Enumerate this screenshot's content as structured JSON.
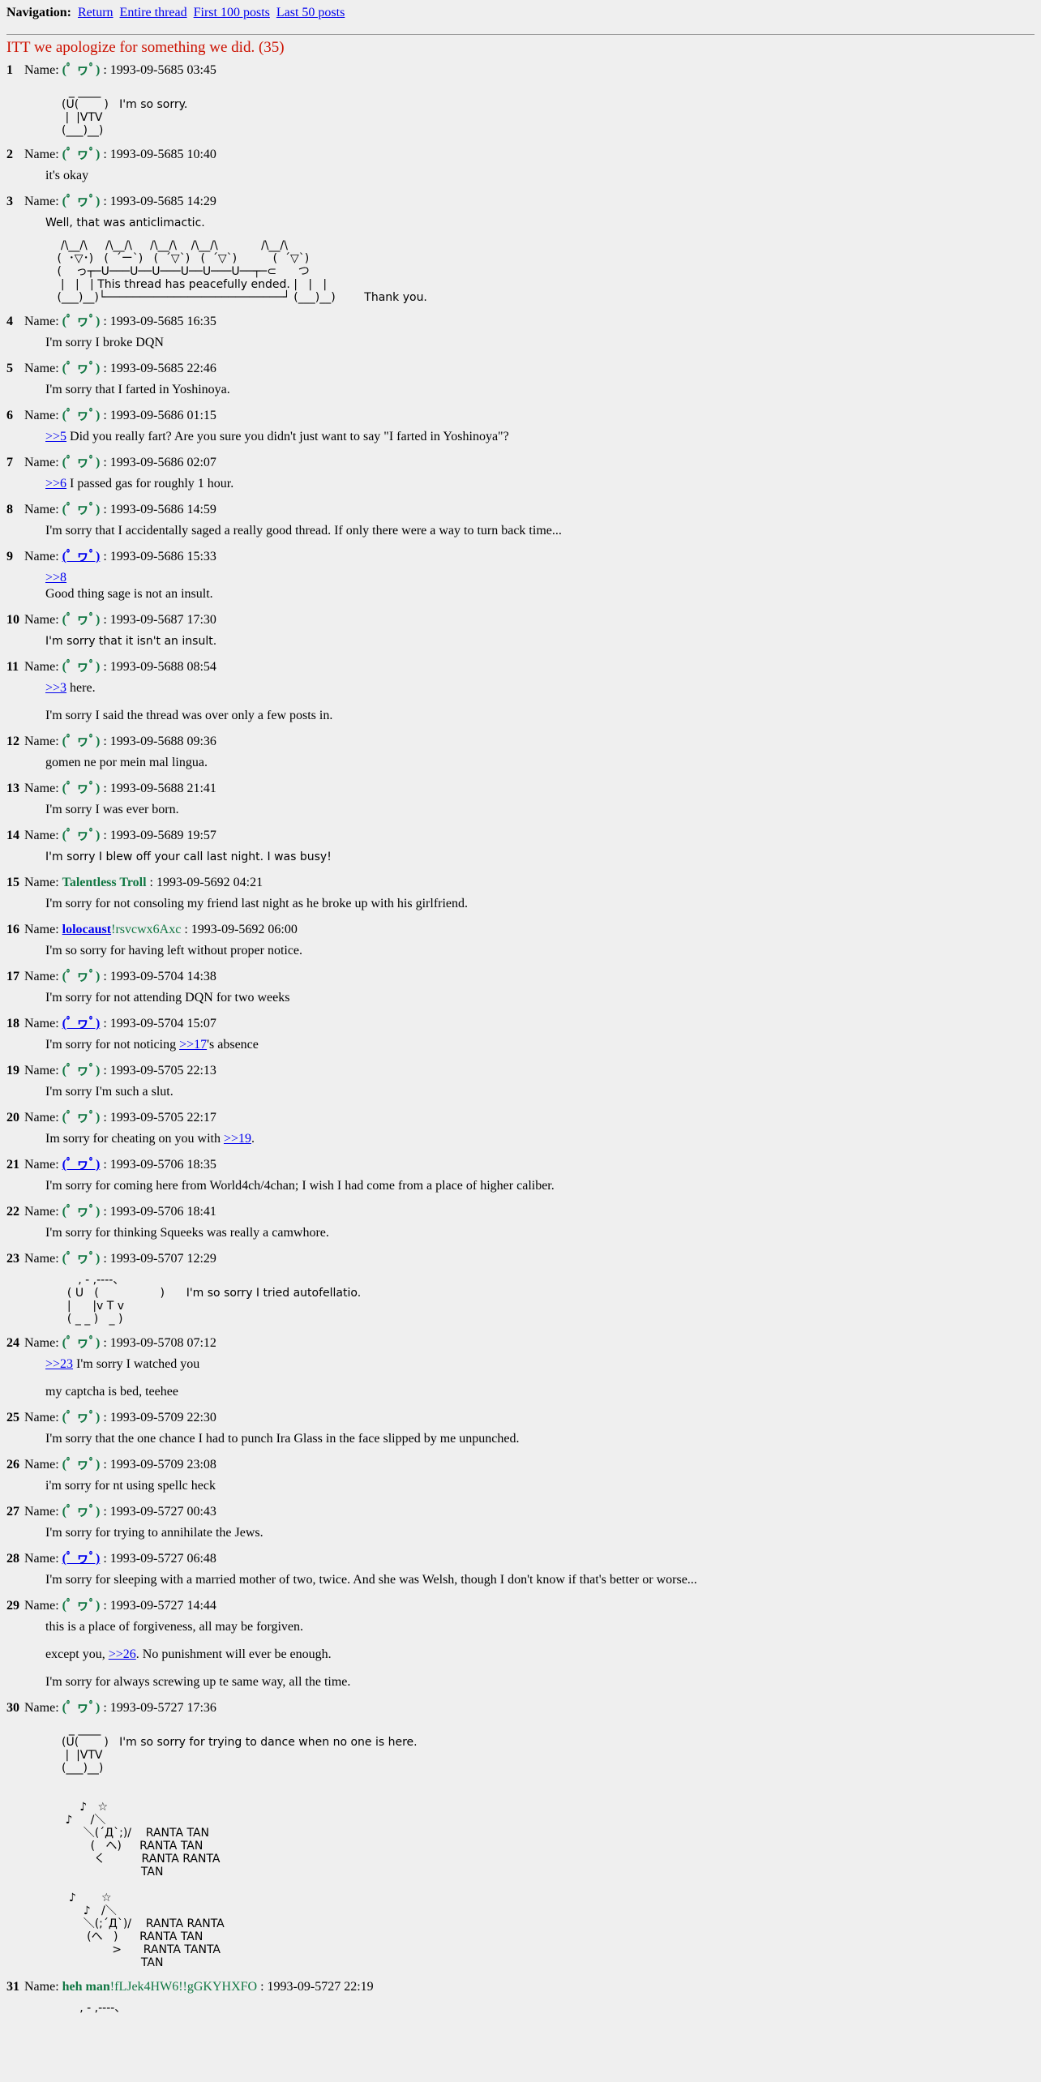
{
  "nav": {
    "label": "Navigation:",
    "links": [
      "Return",
      "Entire thread",
      "First 100 posts",
      "Last 50 posts"
    ]
  },
  "thread": {
    "title": "ITT we apologize for something we did. (35)"
  },
  "default_name": "(ﾟ ヮﾟ)",
  "posts": [
    {
      "num": "1",
      "name": "(ﾟ ヮﾟ)",
      "date": "1993-09-5685 03:45",
      "aa": "  _ ____\n(U(       )   I'm so sorry.\n |  |VTV\n(___)__)"
    },
    {
      "num": "2",
      "name": "(ﾟ ヮﾟ)",
      "date": "1993-09-5685 10:40",
      "lines": [
        "it's okay"
      ]
    },
    {
      "num": "3",
      "name": "(ﾟ ヮﾟ)",
      "date": "1993-09-5685 14:29",
      "lines": [
        "Well, that was anticlimactic."
      ],
      "aa": "  /\\__/\\     /\\__/\\     /\\__/\\    /\\__/\\            /\\__/\\\n (  ･▽･)   (  ´ー`)   (  ´▽`)   (  ´▽`)          (  ´▽`)\n (    っ┬─U───U──U───U──U───U──┬─⊂      つ\n  |   |   | This thread has peacefully ended. |   |   |\n (___)__)└──────────────────────────┘ (___)__)        Thank you."
    },
    {
      "num": "4",
      "name": "(ﾟ ヮﾟ)",
      "date": "1993-09-5685 16:35",
      "lines": [
        "I'm sorry I broke DQN"
      ]
    },
    {
      "num": "5",
      "name": "(ﾟ ヮﾟ)",
      "date": "1993-09-5685 22:46",
      "lines": [
        "I'm sorry that I farted in Yoshinoya."
      ]
    },
    {
      "num": "6",
      "name": "(ﾟ ヮﾟ)",
      "date": "1993-09-5686 01:15",
      "ref": ">>5",
      "lines": [
        " Did you really fart? Are you sure you didn't just want to say \"I farted in Yoshinoya\"?"
      ]
    },
    {
      "num": "7",
      "name": "(ﾟ ヮﾟ)",
      "date": "1993-09-5686 02:07",
      "ref": ">>6",
      "lines": [
        " I passed gas for roughly 1 hour."
      ]
    },
    {
      "num": "8",
      "name": "(ﾟ ヮﾟ)",
      "date": "1993-09-5686 14:59",
      "lines": [
        "I'm sorry that I accidentally saged a really good thread. If only there were a way to turn back time..."
      ]
    },
    {
      "num": "9",
      "name": "(ﾟ ヮﾟ)",
      "date": "1993-09-5686 15:33",
      "ref": ">>8",
      "lines": [
        "Good thing sage is not an insult."
      ]
    },
    {
      "num": "10",
      "name": "(ﾟ ヮﾟ)",
      "date": "1993-09-5687 17:30",
      "lines": [
        "I'm sorry that it isn't an insult."
      ]
    },
    {
      "num": "11",
      "name": "(ﾟ ヮﾟ)",
      "date": "1993-09-5688 08:54",
      "ref": ">>3",
      "lines": [
        " here.",
        "I'm sorry I said the thread was over only a few posts in."
      ]
    },
    {
      "num": "12",
      "name": "(ﾟ ヮﾟ)",
      "date": "1993-09-5688 09:36",
      "lines": [
        "gomen ne por mein mal lingua."
      ]
    },
    {
      "num": "13",
      "name": "(ﾟ ヮﾟ)",
      "date": "1993-09-5688 21:41",
      "lines": [
        "I'm sorry I was ever born."
      ]
    },
    {
      "num": "14",
      "name": "(ﾟ ヮﾟ)",
      "date": "1993-09-5689 19:57",
      "lines": [
        "I'm sorry I blew off your call last night. I was busy!"
      ]
    },
    {
      "num": "15",
      "name": "Talentless Troll",
      "date": "1993-09-5692 04:21",
      "lines": [
        "I'm sorry for not consoling my friend last night as he broke up with his girlfriend."
      ]
    },
    {
      "num": "16",
      "name": "lolocaust",
      "trip": "!rsvcwx6Axc",
      "date": "1993-09-5692 06:00",
      "lines": [
        "I'm so sorry for having left without proper notice."
      ]
    },
    {
      "num": "17",
      "name": "(ﾟ ヮﾟ)",
      "date": "1993-09-5704 14:38",
      "lines": [
        "I'm sorry for not attending DQN for two weeks"
      ]
    },
    {
      "num": "18",
      "name": "(ﾟ ヮﾟ)",
      "date": "1993-09-5704 15:07",
      "lines": [
        "I'm sorry for not noticing ",
        ">>17",
        "'s absence"
      ]
    },
    {
      "num": "19",
      "name": "(ﾟ ヮﾟ)",
      "date": "1993-09-5705 22:13",
      "lines": [
        "I'm sorry I'm such a slut."
      ]
    },
    {
      "num": "20",
      "name": "(ﾟ ヮﾟ)",
      "date": "1993-09-5705 22:17",
      "lines": [
        "Im sorry for cheating on you with ",
        ">>19",
        "."
      ]
    },
    {
      "num": "21",
      "name": "(ﾟ ヮﾟ)",
      "date": "1993-09-5706 18:35",
      "lines": [
        "I'm sorry for coming here from World4ch/4chan; I wish I had come from a place of higher caliber."
      ]
    },
    {
      "num": "22",
      "name": "(ﾟ ヮﾟ)",
      "date": "1993-09-5706 18:41",
      "lines": [
        "I'm sorry for thinking Squeeks was really a camwhore."
      ]
    },
    {
      "num": "23",
      "name": "(ﾟ ヮﾟ)",
      "date": "1993-09-5707 12:29",
      "aa": "     , - ,----、\n  ( U   (                 )      I'm so sorry I tried autofellatio.\n  |      |v T v\n  ( _ _ )   _ )"
    },
    {
      "num": "24",
      "name": "(ﾟ ヮﾟ)",
      "date": "1993-09-5708 07:12",
      "ref": ">>23",
      "lines": [
        " I'm sorry I watched you",
        "my captcha is bed, teehee"
      ]
    },
    {
      "num": "25",
      "name": "(ﾟ ヮﾟ)",
      "date": "1993-09-5709 22:30",
      "lines": [
        "I'm sorry that the one chance I had to punch Ira Glass in the face slipped by me unpunched."
      ]
    },
    {
      "num": "26",
      "name": "(ﾟ ヮﾟ)",
      "date": "1993-09-5709 23:08",
      "lines": [
        "i'm sorry for nt using spellc heck"
      ]
    },
    {
      "num": "27",
      "name": "(ﾟ ヮﾟ)",
      "date": "1993-09-5727 00:43",
      "lines": [
        "I'm sorry for trying to annihilate the Jews."
      ]
    },
    {
      "num": "28",
      "name": "(ﾟ ヮﾟ)",
      "date": "1993-09-5727 06:48",
      "lines": [
        "I'm sorry for sleeping with a married mother of two, twice. And she was Welsh, though I don't know if that's better or worse..."
      ]
    },
    {
      "num": "29",
      "name": "(ﾟ ヮﾟ)",
      "date": "1993-09-5727 14:44",
      "lines": [
        "this is a place of forgiveness, all may be forgiven.",
        "except you, ",
        ">>26",
        ". No punishment will ever be enough.",
        "I'm sorry for always screwing up te same way, all the time."
      ]
    },
    {
      "num": "30",
      "name": "(ﾟ ヮﾟ)",
      "date": "1993-09-5727 17:36",
      "aa": "  _ ____\n(U(       )   I'm so sorry for trying to dance when no one is here.\n |  |VTV\n(___)__)\n\n\n     ♪   ☆\n ♪     /＼\n      ＼(´Д`;)/    RANTA TAN\n        (   へ)     RANTA TAN\n         く          RANTA RANTA\n                      TAN\n\n  ♪       ☆\n      ♪   /＼\n      ＼(;´Д`)/    RANTA RANTA\n       (へ   )      RANTA TAN\n              >      RANTA TANTA\n                      TAN"
    },
    {
      "num": "31",
      "name": "heh man",
      "trip": "!fLJek4HW6!!gGKYHXFO",
      "date": "1993-09-5727 22:19",
      "aa": "     , - ,----、"
    }
  ]
}
